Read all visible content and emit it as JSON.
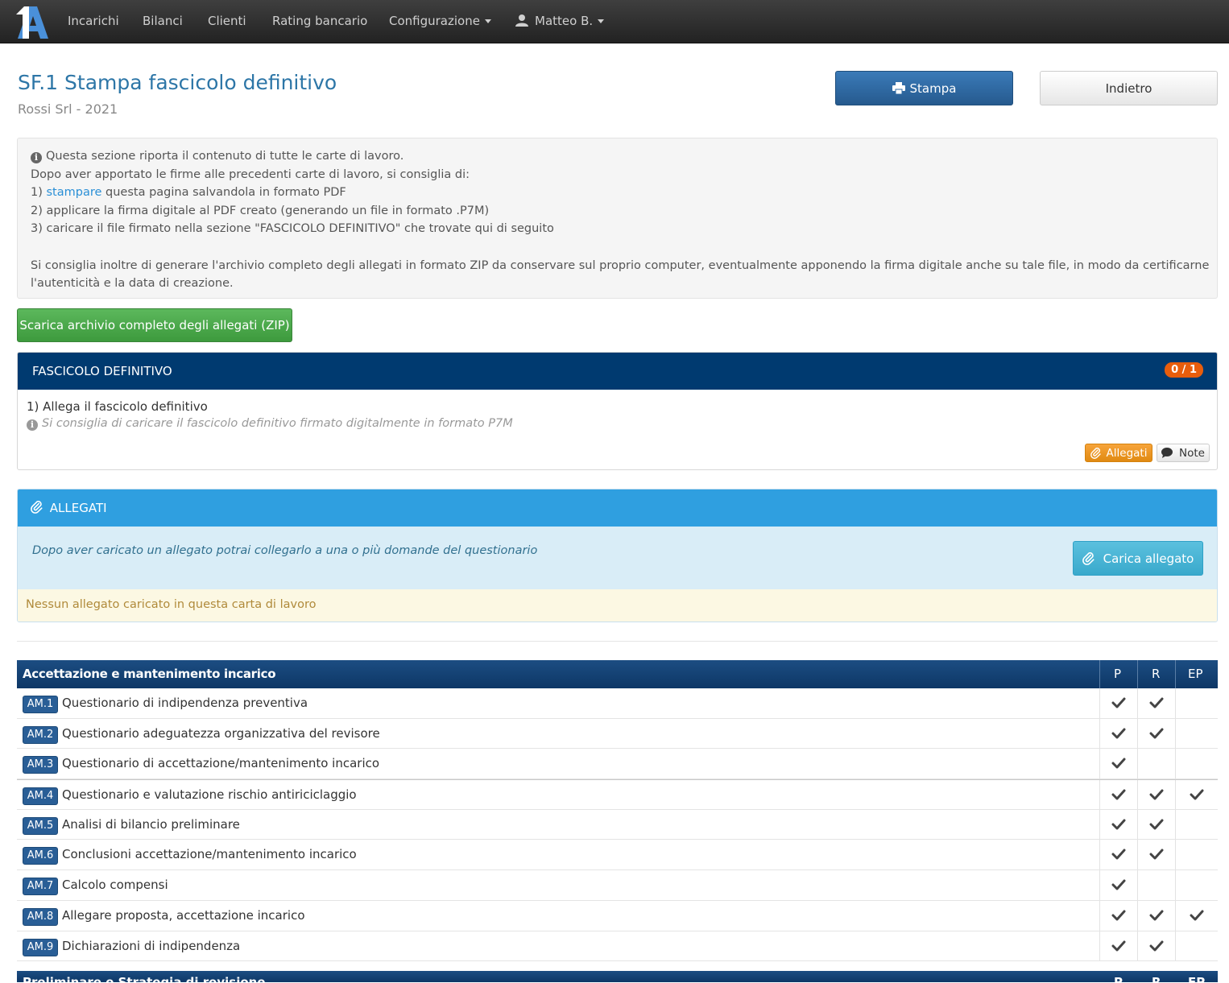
{
  "navbar": {
    "items": [
      "Incarichi",
      "Bilanci",
      "Clienti",
      "Rating bancario"
    ],
    "config_label": "Configurazione",
    "user_label": "Matteo B."
  },
  "header": {
    "title": "SF.1 Stampa fascicolo definitivo",
    "subtitle": "Rossi Srl - 2021",
    "stampa_label": "Stampa",
    "indietro_label": "Indietro"
  },
  "info": {
    "line1": "Questa sezione riporta il contenuto di tutte le carte di lavoro.",
    "line2": "Dopo aver apportato le firme alle precedenti carte di lavoro, si consiglia di:",
    "step1_prefix": "1) ",
    "step1_link": "stampare",
    "step1_suffix": " questa pagina salvandola in formato PDF",
    "step2": "2) applicare la firma digitale al PDF creato (generando un file in formato .P7M)",
    "step3": "3) caricare il file firmato nella sezione \"FASCICOLO DEFINITIVO\" che trovate qui di seguito",
    "para_line1": "Si consiglia inoltre di generare l'archivio completo degli allegati in formato ZIP da conservare sul proprio computer, eventualmente apponendo la firma digitale anche su tale file, in modo da certificarne",
    "para_line2": "l'autenticità e la data di creazione."
  },
  "zip_button": "Scarica archivio completo degli allegati (ZIP)",
  "fascicolo": {
    "title": "FASCICOLO DEFINITIVO",
    "badge": "0 / 1",
    "question": "1) Allega il fascicolo definitivo",
    "hint": "Si consiglia di caricare il fascicolo definitivo firmato digitalmente in formato P7M",
    "allegati_label": "Allegati",
    "note_label": "Note"
  },
  "allegati": {
    "title": "ALLEGATI",
    "hint": "Dopo aver caricato un allegato potrai collegarlo a una o più domande del questionario",
    "carica_label": "Carica allegato",
    "empty_message": "Nessun allegato caricato in questa carta di lavoro"
  },
  "table": {
    "section_title": "Accettazione e mantenimento incarico",
    "columns": [
      "P",
      "R",
      "EP"
    ],
    "rows": [
      {
        "code": "AM.1",
        "label": "Questionario di indipendenza preventiva",
        "p": true,
        "r": true,
        "ep": false
      },
      {
        "code": "AM.2",
        "label": "Questionario adeguatezza organizzativa del revisore",
        "p": true,
        "r": true,
        "ep": false
      },
      {
        "code": "AM.3",
        "label": "Questionario di accettazione/mantenimento incarico",
        "p": true,
        "r": false,
        "ep": false
      },
      {
        "code": "AM.4",
        "label": "Questionario e valutazione rischio antiriciclaggio",
        "p": true,
        "r": true,
        "ep": true
      },
      {
        "code": "AM.5",
        "label": "Analisi di bilancio preliminare",
        "p": true,
        "r": true,
        "ep": false
      },
      {
        "code": "AM.6",
        "label": "Conclusioni accettazione/mantenimento incarico",
        "p": true,
        "r": true,
        "ep": false
      },
      {
        "code": "AM.7",
        "label": "Calcolo compensi",
        "p": true,
        "r": false,
        "ep": false
      },
      {
        "code": "AM.8",
        "label": "Allegare proposta, accettazione incarico",
        "p": true,
        "r": true,
        "ep": true
      },
      {
        "code": "AM.9",
        "label": "Dichiarazioni di indipendenza",
        "p": true,
        "r": true,
        "ep": false
      }
    ],
    "next_section_title": "Preliminare e Strategia di revisione"
  }
}
